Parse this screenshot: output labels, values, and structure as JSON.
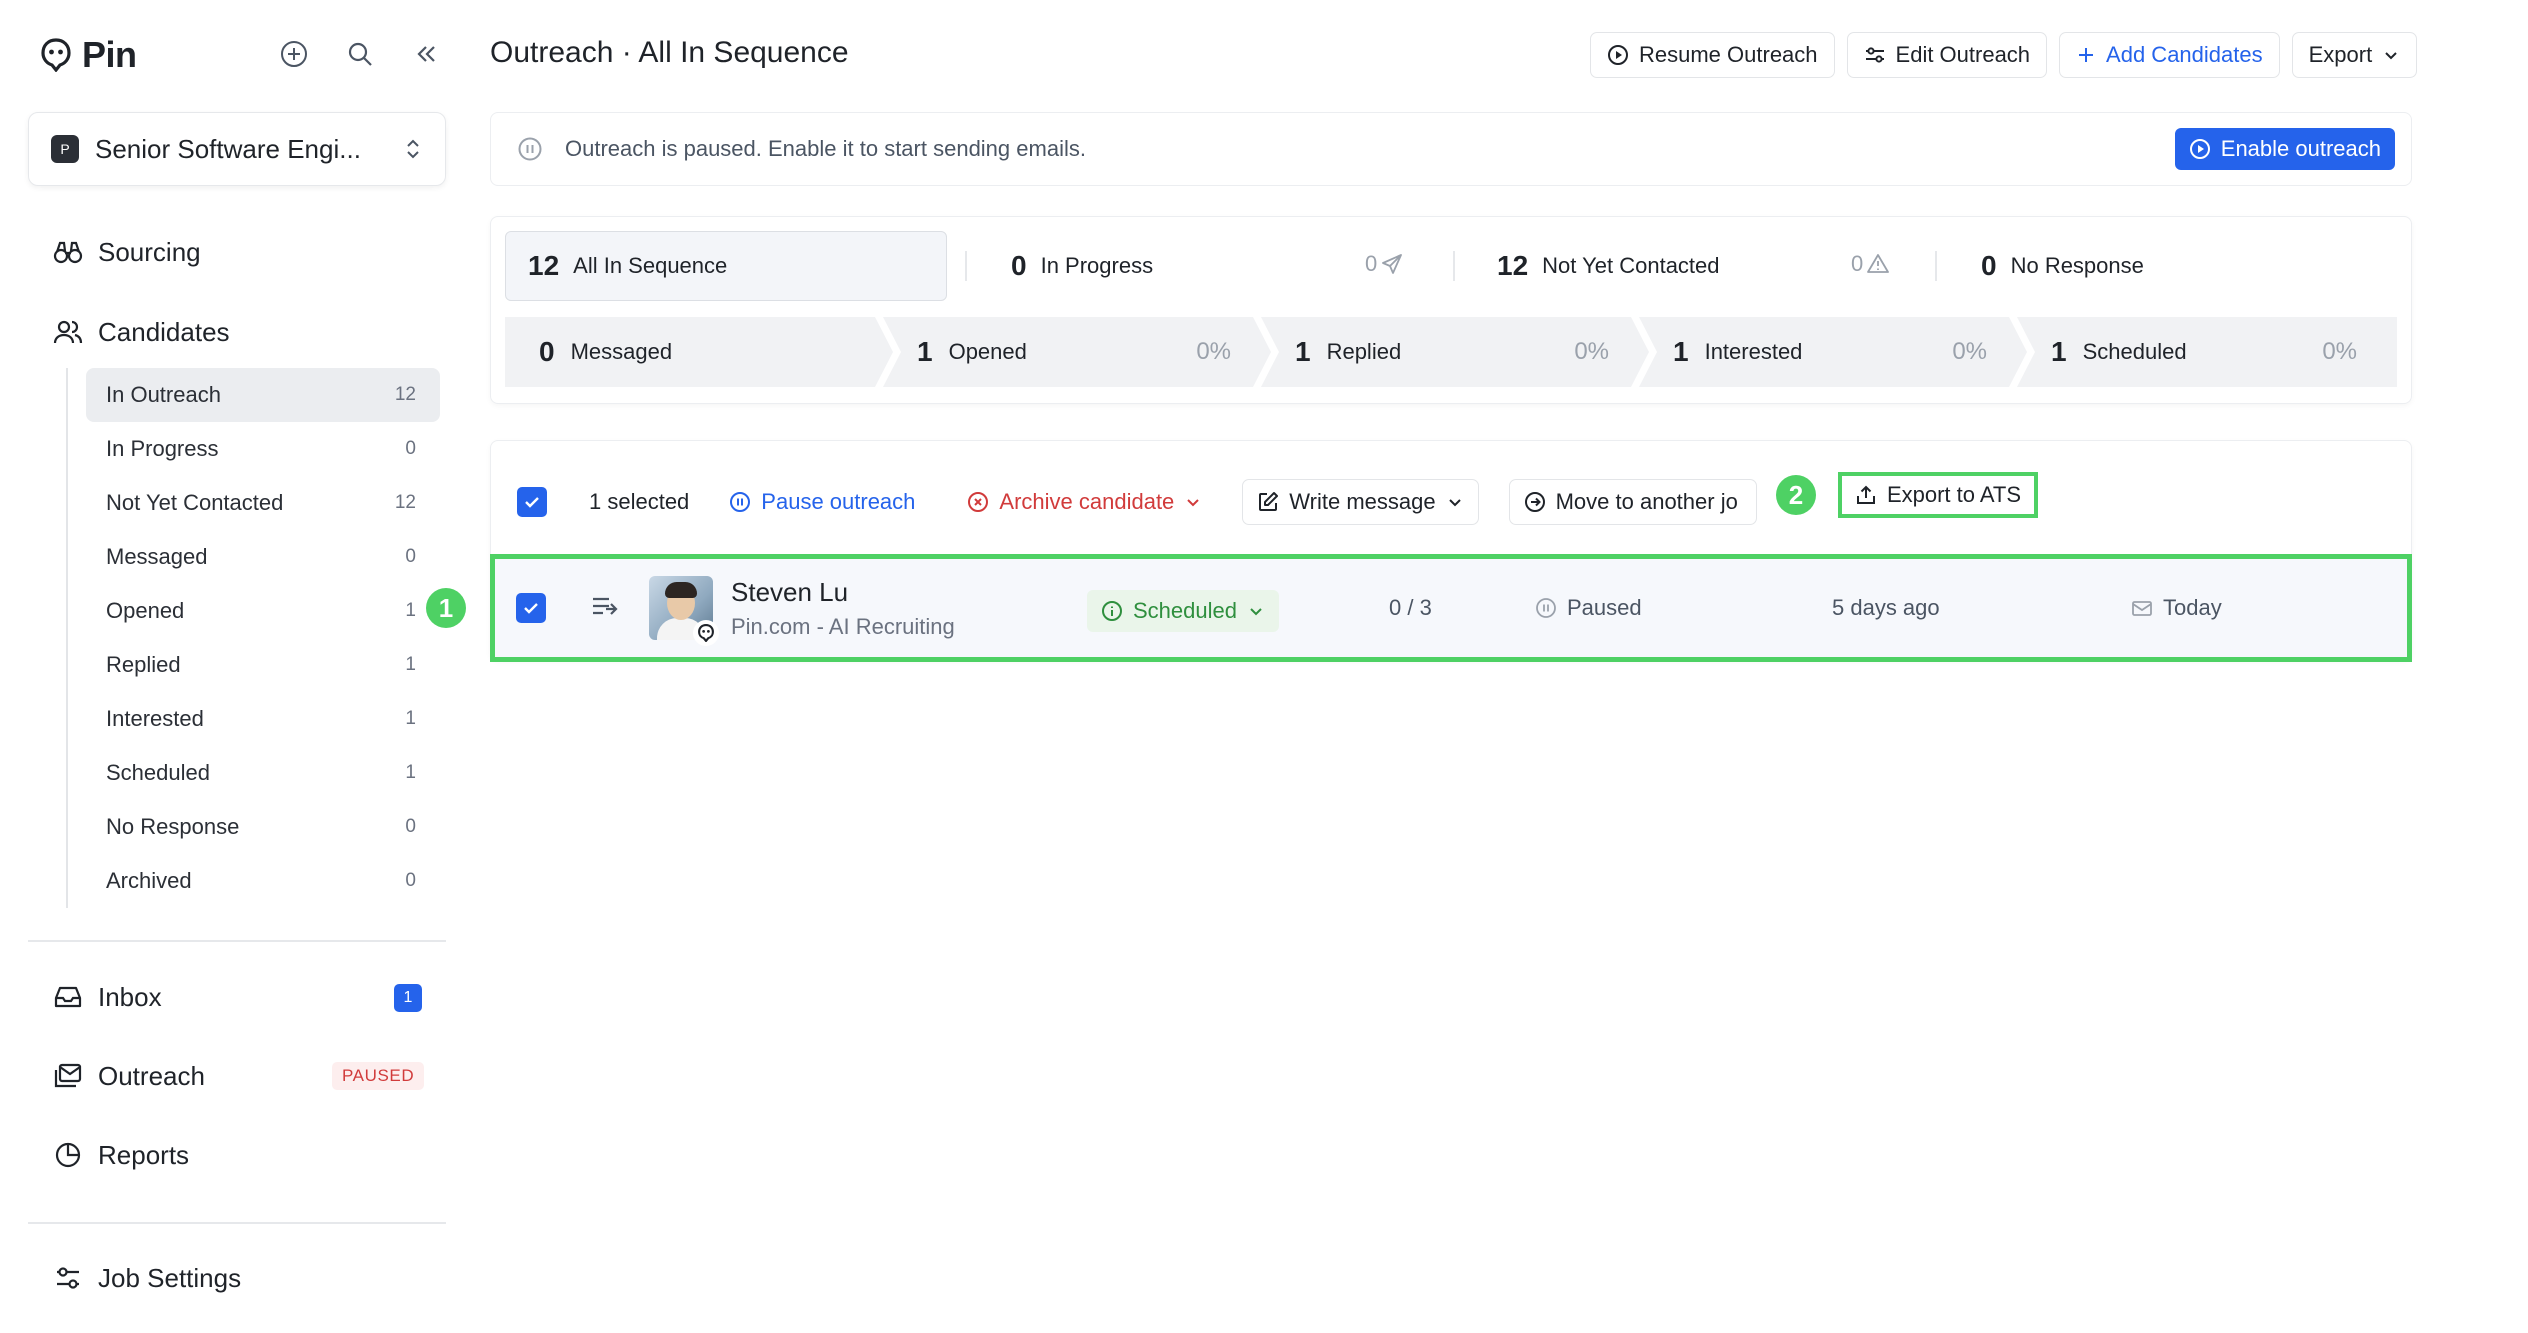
{
  "app": {
    "name": "Pin"
  },
  "job": {
    "badge": "P",
    "name": "Senior Software Engi..."
  },
  "nav": {
    "sourcing": "Sourcing",
    "candidates": "Candidates",
    "inbox": "Inbox",
    "inbox_count": "1",
    "outreach": "Outreach",
    "outreach_status": "PAUSED",
    "reports": "Reports",
    "job_settings": "Job Settings"
  },
  "subnav": [
    {
      "label": "In Outreach",
      "count": "12"
    },
    {
      "label": "In Progress",
      "count": "0"
    },
    {
      "label": "Not Yet Contacted",
      "count": "12"
    },
    {
      "label": "Messaged",
      "count": "0"
    },
    {
      "label": "Opened",
      "count": "1"
    },
    {
      "label": "Replied",
      "count": "1"
    },
    {
      "label": "Interested",
      "count": "1"
    },
    {
      "label": "Scheduled",
      "count": "1"
    },
    {
      "label": "No Response",
      "count": "0"
    },
    {
      "label": "Archived",
      "count": "0"
    }
  ],
  "header": {
    "title": "Outreach · All In Sequence",
    "resume": "Resume Outreach",
    "edit": "Edit Outreach",
    "add": "Add Candidates",
    "export": "Export"
  },
  "banner": {
    "text": "Outreach is paused. Enable it to start sending emails.",
    "button": "Enable outreach"
  },
  "stats": {
    "top": [
      {
        "num": "12",
        "label": "All In Sequence"
      },
      {
        "num": "0",
        "label": "In Progress",
        "right": "0"
      },
      {
        "num": "12",
        "label": "Not Yet Contacted",
        "right": "0"
      },
      {
        "num": "0",
        "label": "No Response"
      }
    ],
    "funnel": [
      {
        "num": "0",
        "label": "Messaged",
        "pct": ""
      },
      {
        "num": "1",
        "label": "Opened",
        "pct": "0%"
      },
      {
        "num": "1",
        "label": "Replied",
        "pct": "0%"
      },
      {
        "num": "1",
        "label": "Interested",
        "pct": "0%"
      },
      {
        "num": "1",
        "label": "Scheduled",
        "pct": "0%"
      }
    ]
  },
  "toolbar": {
    "selected": "1 selected",
    "pause": "Pause outreach",
    "archive": "Archive candidate",
    "write": "Write message",
    "move": "Move to another jo",
    "export_ats": "Export to ATS"
  },
  "annotations": {
    "one": "1",
    "two": "2"
  },
  "candidate": {
    "name": "Steven Lu",
    "company": "Pin.com - AI Recruiting",
    "status": "Scheduled",
    "progress": "0 / 3",
    "state": "Paused",
    "added": "5 days ago",
    "last": "Today"
  },
  "colors": {
    "accent": "#2563eb",
    "highlight": "#4ed164",
    "danger": "#d13b3b",
    "success": "#2f8f3e"
  }
}
